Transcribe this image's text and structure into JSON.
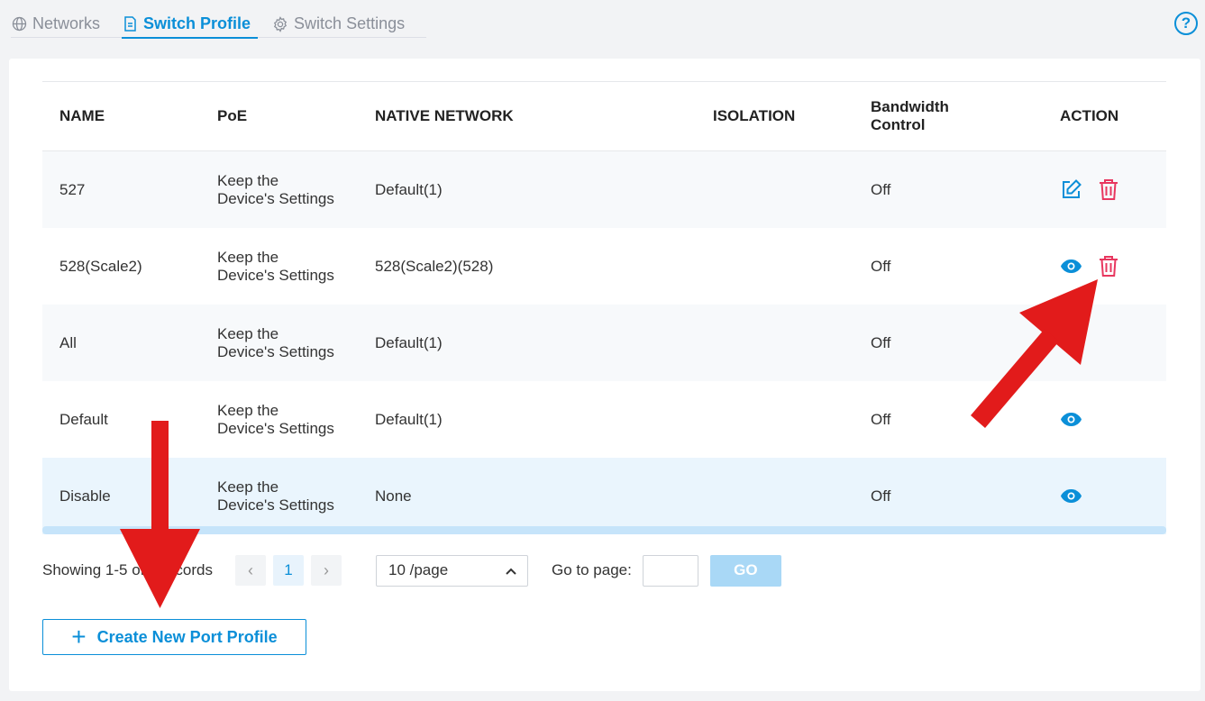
{
  "tabs": [
    {
      "label": "Networks",
      "icon": "globe-icon"
    },
    {
      "label": "Switch Profile",
      "icon": "document-icon"
    },
    {
      "label": "Switch Settings",
      "icon": "gear-icon"
    }
  ],
  "help_label": "?",
  "table": {
    "columns": [
      "NAME",
      "PoE",
      "NATIVE NETWORK",
      "ISOLATION",
      "Bandwidth Control",
      "ACTION"
    ],
    "rows": [
      {
        "name": "527",
        "poe_line1": "Keep the",
        "poe_line2": "Device's Settings",
        "native": "Default(1)",
        "isolation": "",
        "bandwidth": "Off"
      },
      {
        "name": "528(Scale2)",
        "poe_line1": "Keep the",
        "poe_line2": "Device's Settings",
        "native": "528(Scale2)(528)",
        "isolation": "",
        "bandwidth": "Off"
      },
      {
        "name": "All",
        "poe_line1": "Keep the",
        "poe_line2": "Device's Settings",
        "native": "Default(1)",
        "isolation": "",
        "bandwidth": "Off"
      },
      {
        "name": "Default",
        "poe_line1": "Keep the",
        "poe_line2": "Device's Settings",
        "native": "Default(1)",
        "isolation": "",
        "bandwidth": "Off"
      },
      {
        "name": "Disable",
        "poe_line1": "Keep the",
        "poe_line2": "Device's Settings",
        "native": "None",
        "isolation": "",
        "bandwidth": "Off"
      }
    ]
  },
  "pager": {
    "showing": "Showing 1-5 of 5 records",
    "prev": "‹",
    "page": "1",
    "next": "›",
    "page_size": "10 /page",
    "go_to_label": "Go to page:",
    "go_label": "GO"
  },
  "create_button": {
    "plus": "+",
    "label": "Create New Port Profile"
  },
  "colors": {
    "accent": "#0b8fd8",
    "danger": "#e8375f",
    "arrow": "#e21b1b"
  }
}
